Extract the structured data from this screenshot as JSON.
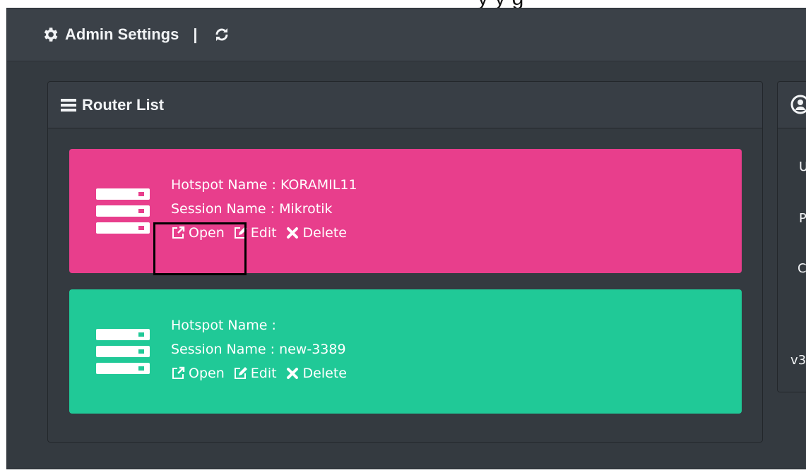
{
  "caption": "y    y  g",
  "admin_header": {
    "title": "Admin Settings",
    "separator": "|"
  },
  "router_list": {
    "title": "Router List",
    "routers": [
      {
        "hotspot": "Hotspot Name : KORAMIL11",
        "session": "Session Name : Mikrotik",
        "color": "#e83e8c",
        "actions": {
          "open": "Open",
          "edit": "Edit",
          "delete": "Delete"
        }
      },
      {
        "hotspot": "Hotspot Name :",
        "session": "Session Name : new-3389",
        "color": "#20c997",
        "actions": {
          "open": "Open",
          "edit": "Edit",
          "delete": "Delete"
        }
      }
    ]
  },
  "side_panel": {
    "labels": [
      "U",
      "P",
      "C",
      "v3"
    ]
  },
  "icons": {
    "admin": "gear-icon",
    "refresh": "refresh-icon",
    "list": "list-icon",
    "router": "server-icon",
    "open": "external-link-icon",
    "edit": "edit-icon",
    "delete": "close-icon",
    "side": "user-circle-icon"
  }
}
